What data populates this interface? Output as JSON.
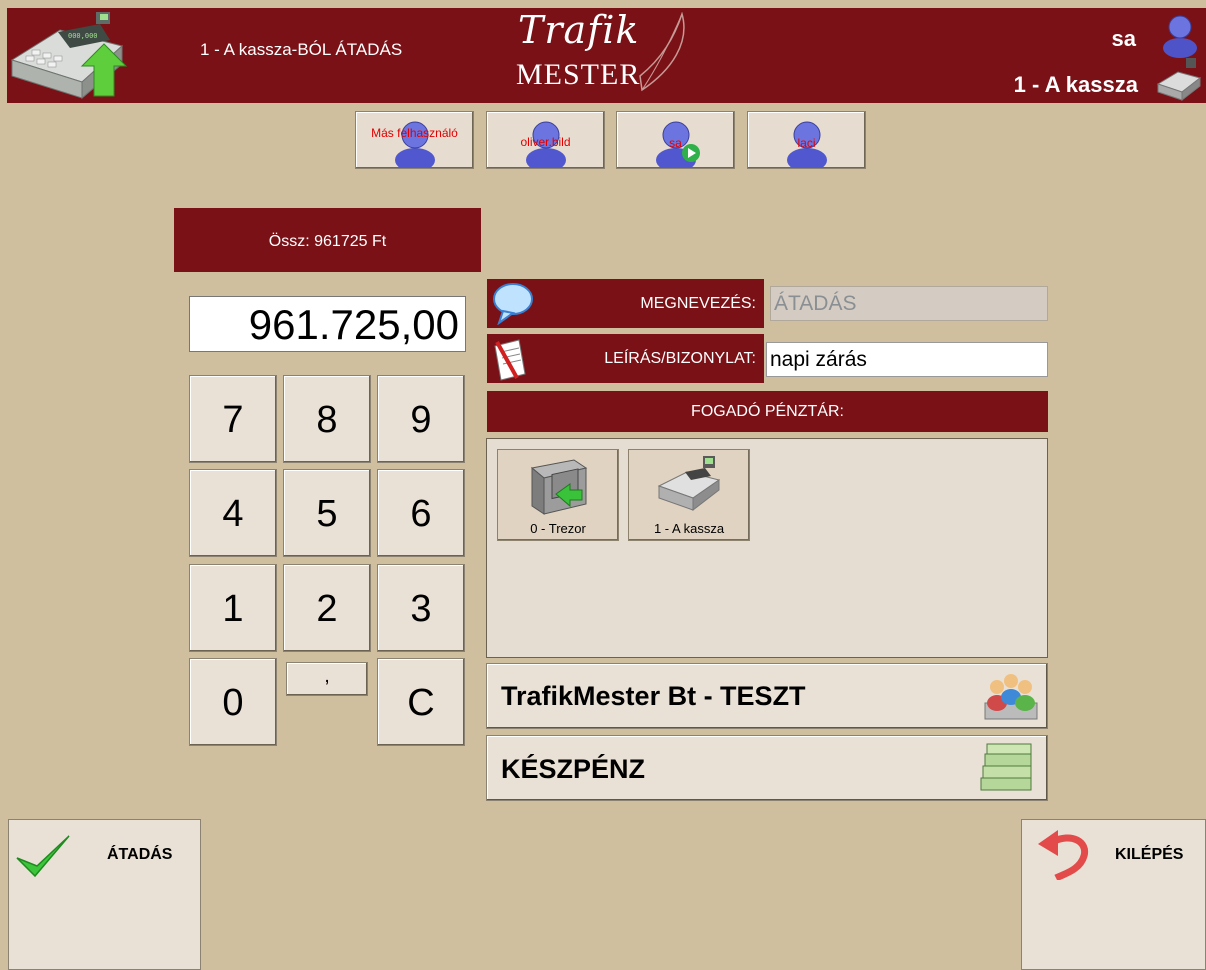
{
  "header": {
    "title": "1 - A kassza-BÓL ÁTADÁS",
    "logo_top": "Trafik",
    "logo_bottom": "MESTER",
    "user": "sa",
    "register": "1 - A kassza"
  },
  "users": [
    {
      "label": "Más felhasználó"
    },
    {
      "label": "oliver.bild"
    },
    {
      "label": "sa"
    },
    {
      "label": "laci"
    }
  ],
  "total": "Össz: 961725 Ft",
  "amount": "961.725,00",
  "keypad": [
    "7",
    "8",
    "9",
    "4",
    "5",
    "6",
    "1",
    "2",
    "3",
    "0",
    ",",
    "C"
  ],
  "form": {
    "name_label": "MEGNEVEZÉS:",
    "name_value": "ÁTADÁS",
    "desc_label": "LEÍRÁS/BIZONYLAT:",
    "desc_value": "napi zárás"
  },
  "receiver": {
    "title": "FOGADÓ PÉNZTÁR:",
    "options": [
      {
        "label": "0 - Trezor"
      },
      {
        "label": "1 - A kassza"
      }
    ]
  },
  "partner": "TrafikMester Bt - TESZT",
  "payment": "KÉSZPÉNZ",
  "footer": {
    "confirm": "ÁTADÁS",
    "exit": "KILÉPÉS"
  },
  "colors": {
    "header_bg": "#7a1116",
    "page_bg": "#cfbf9f",
    "button_bg": "#e9e1d6",
    "user_label": "#e20000"
  }
}
